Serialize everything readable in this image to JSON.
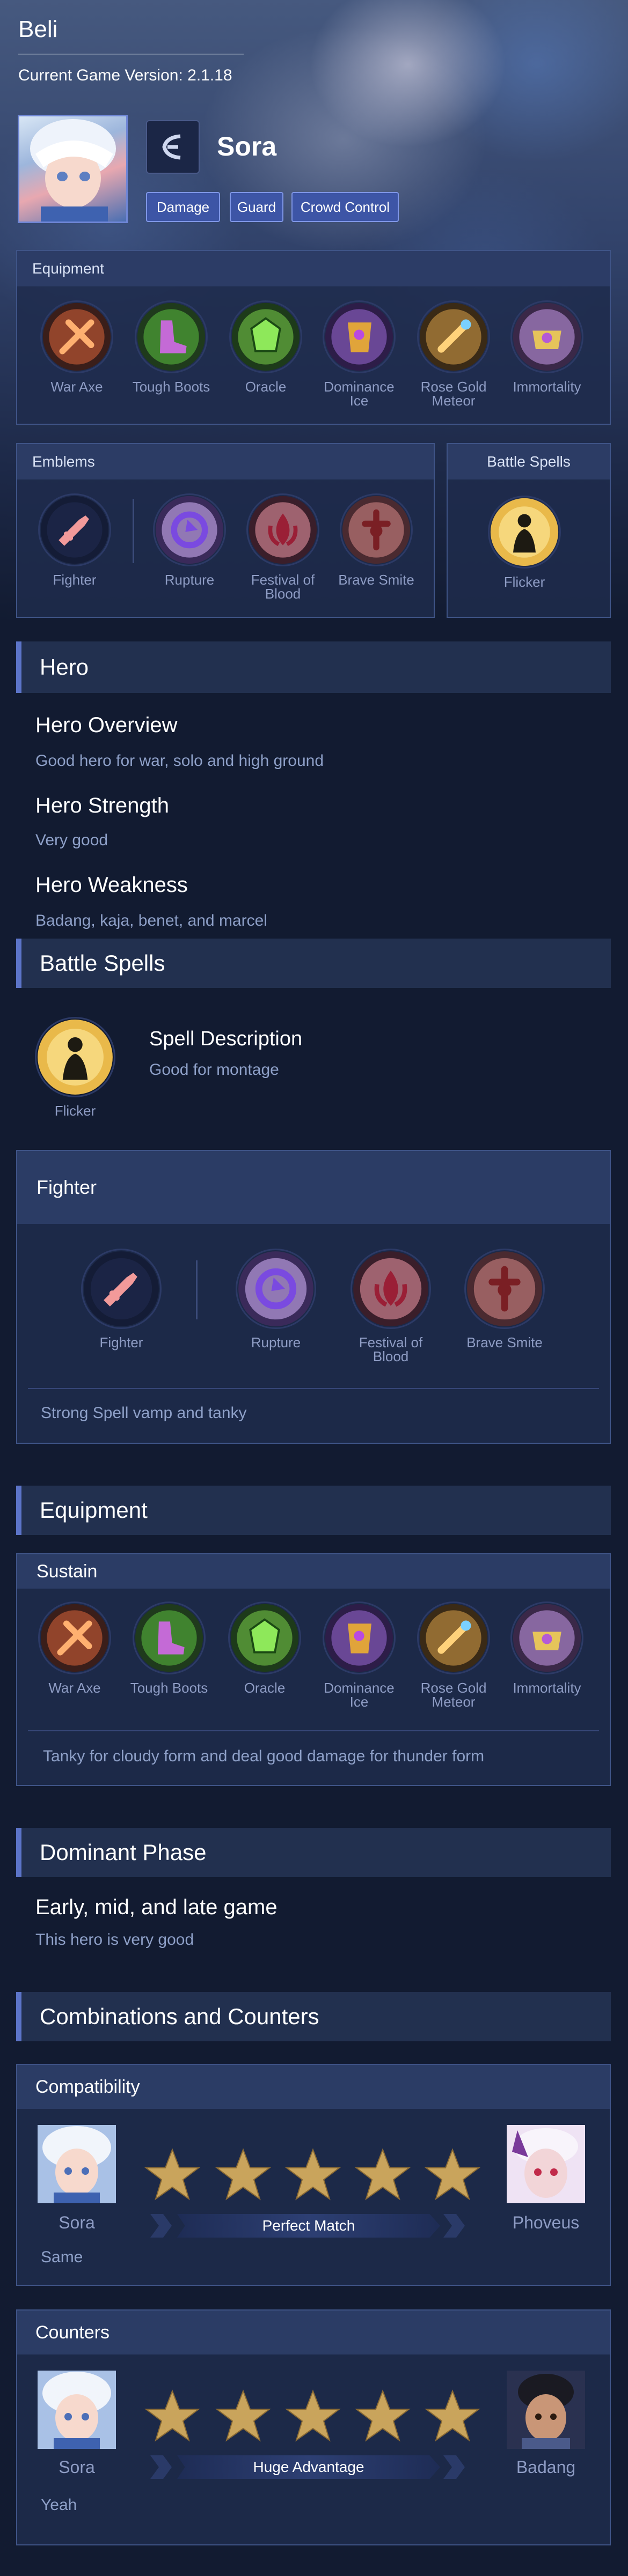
{
  "header": {
    "username": "Beli",
    "version": "Current Game Version: 2.1.18",
    "hero_name": "Sora",
    "tags": [
      "Damage",
      "Guard",
      "Crowd Control"
    ]
  },
  "top_equipment": {
    "title": "Equipment",
    "items": [
      {
        "label": "War Axe",
        "icon": "war-axe-icon"
      },
      {
        "label": "Tough Boots",
        "icon": "tough-boots-icon"
      },
      {
        "label": "Oracle",
        "icon": "oracle-icon"
      },
      {
        "label": "Dominance Ice",
        "icon": "dominance-ice-icon"
      },
      {
        "label": "Rose Gold Meteor",
        "icon": "rose-gold-meteor-icon"
      },
      {
        "label": "Immortality",
        "icon": "immortality-icon"
      }
    ]
  },
  "top_emblems": {
    "title": "Emblems",
    "items": [
      {
        "label": "Fighter"
      },
      {
        "label": "Rupture"
      },
      {
        "label": "Festival of Blood"
      },
      {
        "label": "Brave Smite"
      }
    ]
  },
  "top_spells": {
    "title": "Battle Spells",
    "spell": "Flicker"
  },
  "hero_section": {
    "title": "Hero",
    "overview_title": "Hero Overview",
    "overview": "Good hero for war, solo and high ground",
    "strength_title": "Hero Strength",
    "strength": "Very good",
    "weakness_title": "Hero Weakness",
    "weakness": "Badang, kaja, benet, and marcel"
  },
  "spells_section": {
    "title": "Battle Spells",
    "spell": "Flicker",
    "desc_title": "Spell Description",
    "desc": "Good for montage"
  },
  "emblem_section": {
    "title": "Fighter",
    "items": [
      {
        "label": "Fighter"
      },
      {
        "label": "Rupture"
      },
      {
        "label": "Festival of Blood"
      },
      {
        "label": "Brave Smite"
      }
    ],
    "note": "Strong Spell vamp and tanky"
  },
  "equipment_section": {
    "title": "Equipment",
    "sub_title": "Sustain",
    "items": [
      {
        "label": "War Axe"
      },
      {
        "label": "Tough Boots"
      },
      {
        "label": "Oracle"
      },
      {
        "label": "Dominance Ice"
      },
      {
        "label": "Rose Gold Meteor"
      },
      {
        "label": "Immortality"
      }
    ],
    "note": "Tanky for cloudy form and deal good damage for thunder form"
  },
  "dominant": {
    "title": "Dominant Phase",
    "phase": "Early, mid, and late game",
    "desc": "This hero is very good"
  },
  "combos": {
    "title": "Combinations and Counters",
    "compat": {
      "title": "Compatibility",
      "left": "Sora",
      "right": "Phoveus",
      "rating": 5,
      "banner": "Perfect Match",
      "note": "Same"
    },
    "counters": {
      "title": "Counters",
      "left": "Sora",
      "right": "Badang",
      "rating": 5,
      "banner": "Huge Advantage",
      "note": "Yeah"
    }
  },
  "colors": {
    "accent": "#5c74c8",
    "panel": "#1e2b4c",
    "star": "#c9a45c"
  }
}
